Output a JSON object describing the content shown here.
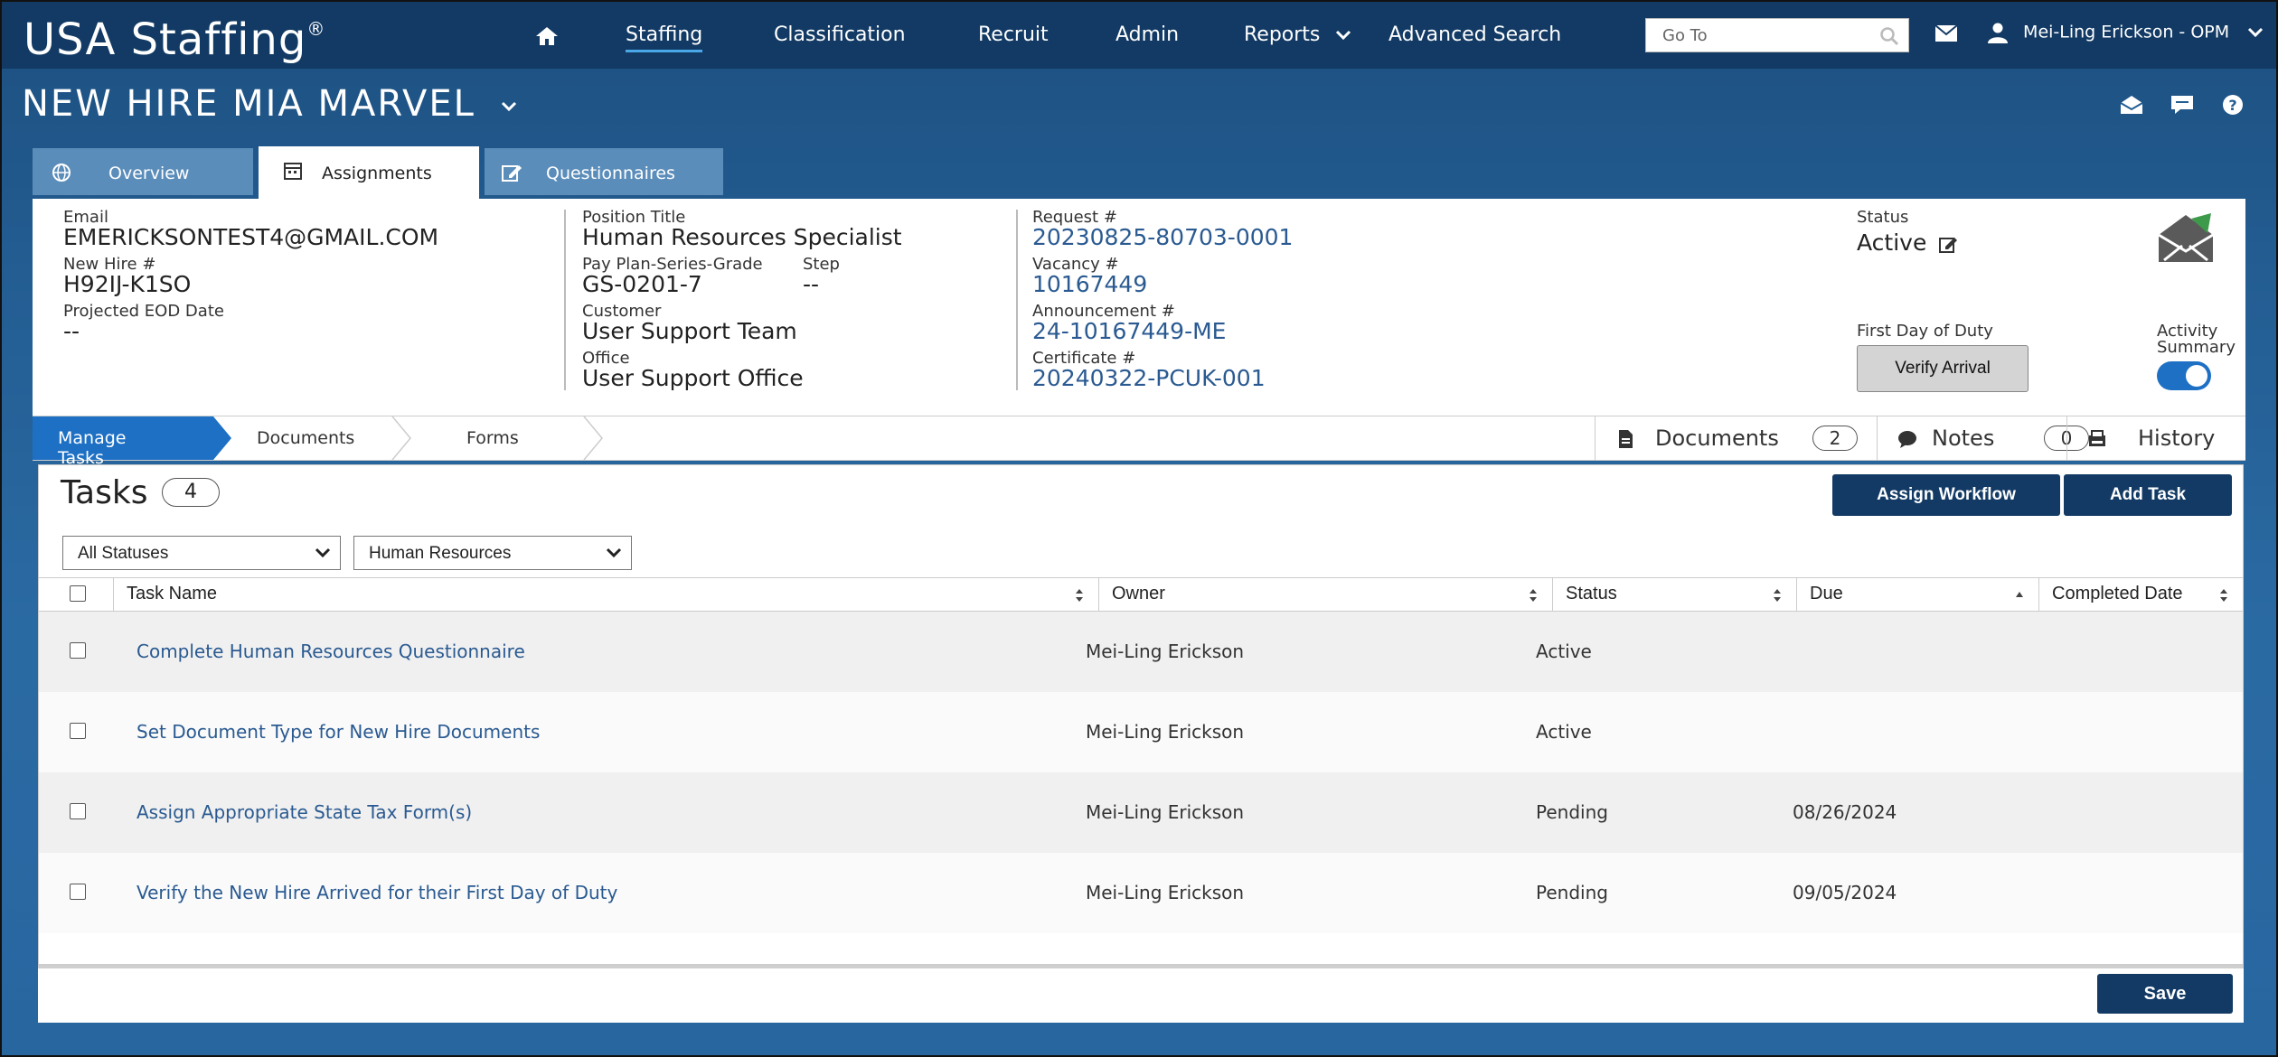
{
  "app": {
    "brand": "USA Staffing",
    "brand_mark": "®"
  },
  "nav": {
    "items": [
      {
        "label": "Staffing",
        "active": true
      },
      {
        "label": "Classification"
      },
      {
        "label": "Recruit"
      },
      {
        "label": "Admin"
      },
      {
        "label": "Reports"
      },
      {
        "label": "Advanced Search"
      }
    ],
    "goto_placeholder": "Go To",
    "user": "Mei-Ling Erickson - OPM"
  },
  "page": {
    "title": "NEW HIRE MIA MARVEL"
  },
  "tabs": [
    {
      "label": "Overview",
      "icon": "globe-icon"
    },
    {
      "label": "Assignments",
      "icon": "calendar-icon",
      "active": true
    },
    {
      "label": "Questionnaires",
      "icon": "edit-icon"
    }
  ],
  "info": {
    "email_label": "Email",
    "email": "EMERICKSONTEST4@GMAIL.COM",
    "new_hire_label": "New Hire #",
    "new_hire": "H92IJ-K1SO",
    "eod_label": "Projected EOD Date",
    "eod": "--",
    "position_label": "Position Title",
    "position": "Human Resources Specialist",
    "ppsg_label": "Pay Plan-Series-Grade",
    "ppsg": "GS-0201-7",
    "step_label": "Step",
    "step": "--",
    "customer_label": "Customer",
    "customer": "User Support Team",
    "office_label": "Office",
    "office": "User Support Office",
    "request_label": "Request #",
    "request": "20230825-80703-0001",
    "vacancy_label": "Vacancy #",
    "vacancy": "10167449",
    "announcement_label": "Announcement #",
    "announcement": "24-10167449-ME",
    "certificate_label": "Certificate #",
    "certificate": "20240322-PCUK-001",
    "status_label": "Status",
    "status": "Active",
    "fdod_label": "First Day of Duty",
    "verify_button": "Verify Arrival",
    "activity_label_1": "Activity",
    "activity_label_2": "Summary",
    "activity_on": true
  },
  "subnav": {
    "steps": [
      "Manage Tasks",
      "Documents",
      "Forms"
    ],
    "right": [
      {
        "label": "Documents",
        "count": "2",
        "icon": "document-icon"
      },
      {
        "label": "Notes",
        "count": "0",
        "icon": "comment-icon"
      },
      {
        "label": "History",
        "icon": "history-icon"
      }
    ]
  },
  "tasks": {
    "title": "Tasks",
    "count": "4",
    "assign_workflow": "Assign Workflow",
    "add_task": "Add Task",
    "filter_status": "All Statuses",
    "filter_group": "Human Resources",
    "columns": [
      "Task Name",
      "Owner",
      "Status",
      "Due",
      "Completed Date"
    ],
    "rows": [
      {
        "name": "Complete Human Resources Questionnaire",
        "owner": "Mei-Ling Erickson",
        "status": "Active",
        "due": "",
        "completed": ""
      },
      {
        "name": "Set Document Type for New Hire Documents",
        "owner": "Mei-Ling Erickson",
        "status": "Active",
        "due": "",
        "completed": ""
      },
      {
        "name": "Assign Appropriate State Tax Form(s)",
        "owner": "Mei-Ling Erickson",
        "status": "Pending",
        "due": "08/26/2024",
        "completed": ""
      },
      {
        "name": "Verify the New Hire Arrived for their First Day of Duty",
        "owner": "Mei-Ling Erickson",
        "status": "Pending",
        "due": "09/05/2024",
        "completed": ""
      }
    ],
    "save": "Save"
  },
  "colors": {
    "navy": "#123a64",
    "link": "#2a5a91",
    "step_active": "#1d70c4"
  }
}
